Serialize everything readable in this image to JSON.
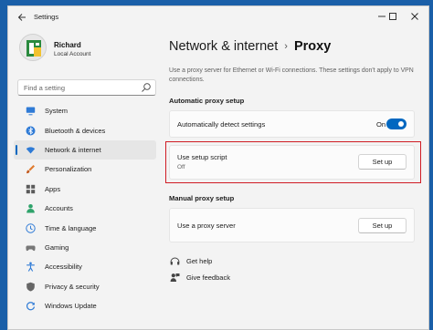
{
  "window": {
    "title": "Settings"
  },
  "user": {
    "name": "Richard",
    "account": "Local Account"
  },
  "search": {
    "placeholder": "Find a setting"
  },
  "sidebar": {
    "items": [
      {
        "label": "System",
        "icon": "monitor-icon",
        "color": "#2f7bd6"
      },
      {
        "label": "Bluetooth & devices",
        "icon": "bluetooth-icon",
        "color": "#2f7bd6"
      },
      {
        "label": "Network & internet",
        "icon": "wifi-icon",
        "color": "#2f7bd6",
        "active": true
      },
      {
        "label": "Personalization",
        "icon": "brush-icon",
        "color": "#e07a2e"
      },
      {
        "label": "Apps",
        "icon": "apps-icon",
        "color": "#5a5a5a"
      },
      {
        "label": "Accounts",
        "icon": "person-icon",
        "color": "#2fa36b"
      },
      {
        "label": "Time & language",
        "icon": "globe-clock-icon",
        "color": "#2f7bd6"
      },
      {
        "label": "Gaming",
        "icon": "gamepad-icon",
        "color": "#777777"
      },
      {
        "label": "Accessibility",
        "icon": "accessibility-icon",
        "color": "#2f7bd6"
      },
      {
        "label": "Privacy & security",
        "icon": "shield-icon",
        "color": "#666666"
      },
      {
        "label": "Windows Update",
        "icon": "update-icon",
        "color": "#2f7bd6"
      }
    ]
  },
  "header": {
    "parent": "Network & internet",
    "separator": "›",
    "current": "Proxy"
  },
  "description": "Use a proxy server for Ethernet or Wi-Fi connections. These settings don't apply to VPN connections.",
  "automatic": {
    "heading": "Automatic proxy setup",
    "detect_label": "Automatically detect settings",
    "detect_state": "On",
    "script_label": "Use setup script",
    "script_state": "Off",
    "script_button": "Set up"
  },
  "manual": {
    "heading": "Manual proxy setup",
    "label": "Use a proxy server",
    "button": "Set up"
  },
  "links": {
    "help": "Get help",
    "feedback": "Give feedback"
  },
  "colors": {
    "accent": "#0067c0",
    "highlight": "#d01c24"
  }
}
